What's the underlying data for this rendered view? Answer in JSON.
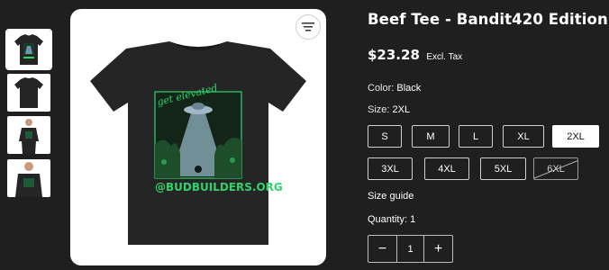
{
  "product": {
    "title": "Beef Tee - Bandit420 Edition",
    "price": "$23.28",
    "tax_note": "Excl. Tax",
    "color_label": "Color:",
    "color_value": "Black",
    "size_label": "Size:",
    "size_value": "2XL",
    "sizes": [
      {
        "label": "S",
        "state": "available"
      },
      {
        "label": "M",
        "state": "available"
      },
      {
        "label": "L",
        "state": "available"
      },
      {
        "label": "XL",
        "state": "available"
      },
      {
        "label": "2XL",
        "state": "selected"
      },
      {
        "label": "3XL",
        "state": "available"
      },
      {
        "label": "4XL",
        "state": "available"
      },
      {
        "label": "5XL",
        "state": "available"
      },
      {
        "label": "6XL",
        "state": "unavailable"
      }
    ],
    "size_guide": "Size guide",
    "quantity_label": "Quantity: 1",
    "quantity_value": "1",
    "minus_symbol": "−",
    "plus_symbol": "+"
  },
  "image": {
    "print_text_top": "get elevated",
    "print_text_bottom": "@BUDBUILDERS.ORG",
    "shirt_color": "#252525",
    "accent_color": "#2fd36a",
    "beam_color": "#bfe8ff"
  },
  "gallery": {
    "thumbnails": [
      "shirt-front-thumbnail",
      "shirt-back-thumbnail",
      "model-front-thumbnail",
      "model-closeup-thumbnail"
    ],
    "active_index": 0
  },
  "icons": {
    "sort": "sort-lines-icon"
  }
}
